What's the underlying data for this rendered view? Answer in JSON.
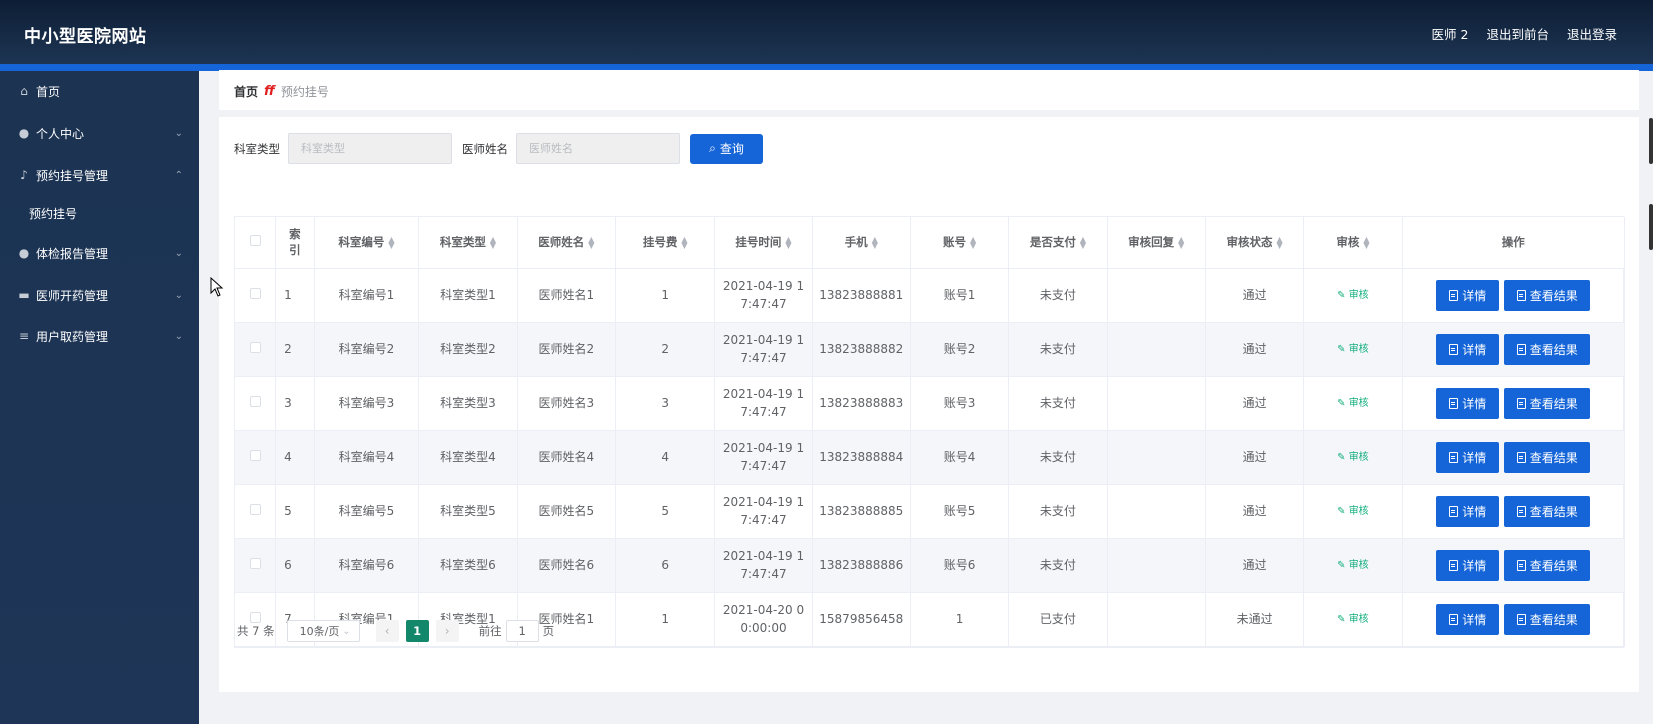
{
  "app": {
    "title": "中小型医院网站"
  },
  "topbar": {
    "user": "医师 2",
    "back_to_front": "退出到前台",
    "logout": "退出登录"
  },
  "sidebar": {
    "items": [
      {
        "label": "首页",
        "icon": "home-icon",
        "arrow": ""
      },
      {
        "label": "个人中心",
        "icon": "user-icon",
        "arrow": "⌄"
      },
      {
        "label": "预约挂号管理",
        "icon": "mic-icon",
        "arrow": "⌃"
      },
      {
        "label": "体检报告管理",
        "icon": "user-icon",
        "arrow": "⌄"
      },
      {
        "label": "医师开药管理",
        "icon": "message-icon",
        "arrow": "⌄"
      },
      {
        "label": "用户取药管理",
        "icon": "menu-icon",
        "arrow": "⌄"
      }
    ],
    "subitems": [
      {
        "label": "预约挂号"
      }
    ]
  },
  "breadcrumb": {
    "home": "首页",
    "separator": "ff",
    "current": "预约挂号"
  },
  "search": {
    "dept_type_label": "科室类型",
    "dept_type_placeholder": "科室类型",
    "doctor_label": "医师姓名",
    "doctor_placeholder": "医师姓名",
    "button": "查询"
  },
  "table": {
    "headers": [
      "索引",
      "科室编号",
      "科室类型",
      "医师姓名",
      "挂号费",
      "挂号时间",
      "手机",
      "账号",
      "是否支付",
      "审核回复",
      "审核状态",
      "审核",
      "操作"
    ],
    "rows": [
      [
        "1",
        "科室编号1",
        "科室类型1",
        "医师姓名1",
        "1",
        "2021-04-19 1\n7:47:47",
        "13823888881",
        "账号1",
        "未支付",
        "",
        "通过",
        "审核"
      ],
      [
        "2",
        "科室编号2",
        "科室类型2",
        "医师姓名2",
        "2",
        "2021-04-19 1\n7:47:47",
        "13823888882",
        "账号2",
        "未支付",
        "",
        "通过",
        "审核"
      ],
      [
        "3",
        "科室编号3",
        "科室类型3",
        "医师姓名3",
        "3",
        "2021-04-19 1\n7:47:47",
        "13823888883",
        "账号3",
        "未支付",
        "",
        "通过",
        "审核"
      ],
      [
        "4",
        "科室编号4",
        "科室类型4",
        "医师姓名4",
        "4",
        "2021-04-19 1\n7:47:47",
        "13823888884",
        "账号4",
        "未支付",
        "",
        "通过",
        "审核"
      ],
      [
        "5",
        "科室编号5",
        "科室类型5",
        "医师姓名5",
        "5",
        "2021-04-19 1\n7:47:47",
        "13823888885",
        "账号5",
        "未支付",
        "",
        "通过",
        "审核"
      ],
      [
        "6",
        "科室编号6",
        "科室类型6",
        "医师姓名6",
        "6",
        "2021-04-19 1\n7:47:47",
        "13823888886",
        "账号6",
        "未支付",
        "",
        "通过",
        "审核"
      ],
      [
        "7",
        "科室编号1",
        "科室类型1",
        "医师姓名1",
        "1",
        "2021-04-20 0\n0:00:00",
        "15879856458",
        "1",
        "已支付",
        "",
        "未通过",
        "审核"
      ]
    ],
    "detail_btn": "详情",
    "result_btn": "查看结果"
  },
  "pagination": {
    "total": "共 7 条",
    "page_size": "10条/页",
    "current_page": "1",
    "goto_prefix": "前往",
    "goto_value": "1",
    "goto_suffix": "页"
  },
  "colors": {
    "primary": "#1565d8",
    "header_bg": "#0e1d35",
    "sidebar_bg": "#1e3557",
    "audit": "#13ae7d",
    "page_active": "#13876a"
  }
}
